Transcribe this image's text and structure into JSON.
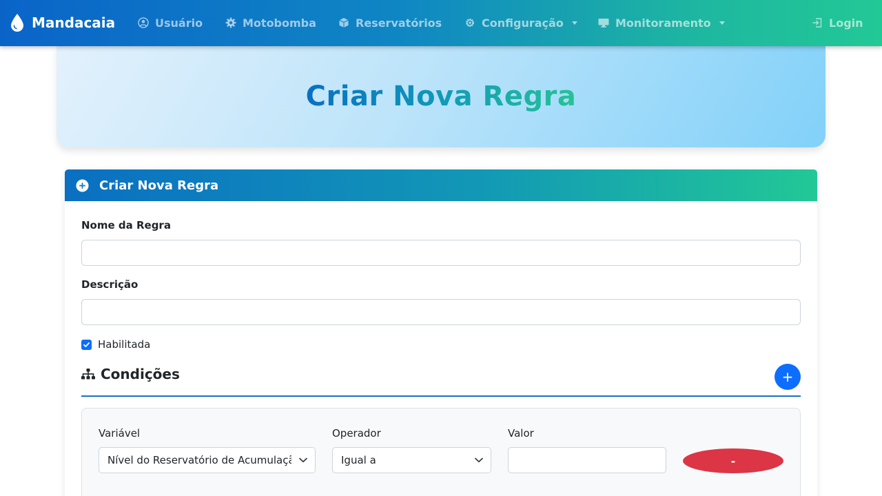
{
  "navbar": {
    "brand": "Mandacaia",
    "items": [
      {
        "label": "Usuário",
        "icon": "user-circle-icon"
      },
      {
        "label": "Motobomba",
        "icon": "cog-icon"
      },
      {
        "label": "Reservatórios",
        "icon": "cube-icon"
      },
      {
        "label": "Configuração",
        "icon": "gear-icon",
        "dropdown": true
      },
      {
        "label": "Monitoramento",
        "icon": "monitor-icon",
        "dropdown": true
      }
    ],
    "login": "Login"
  },
  "hero": {
    "title": "Criar Nova Regra"
  },
  "card": {
    "header": "Criar Nova Regra",
    "name_label": "Nome da Regra",
    "name_value": "",
    "description_label": "Descrição",
    "description_value": "",
    "enabled_label": "Habilitada",
    "enabled": true,
    "conditions_title": "Condições",
    "add_condition_label": "+",
    "condition": {
      "variable_label": "Variável",
      "variable_value": "Nível do Reservatório de Acumulação",
      "operator_label": "Operador",
      "operator_value": "Igual a",
      "value_label": "Valor",
      "value_value": "",
      "remove_label": "-"
    }
  },
  "colors": {
    "primary": "#0d6efd",
    "danger": "#dc3545",
    "gradient_start": "#0a6fc2",
    "gradient_end": "#22c896"
  }
}
